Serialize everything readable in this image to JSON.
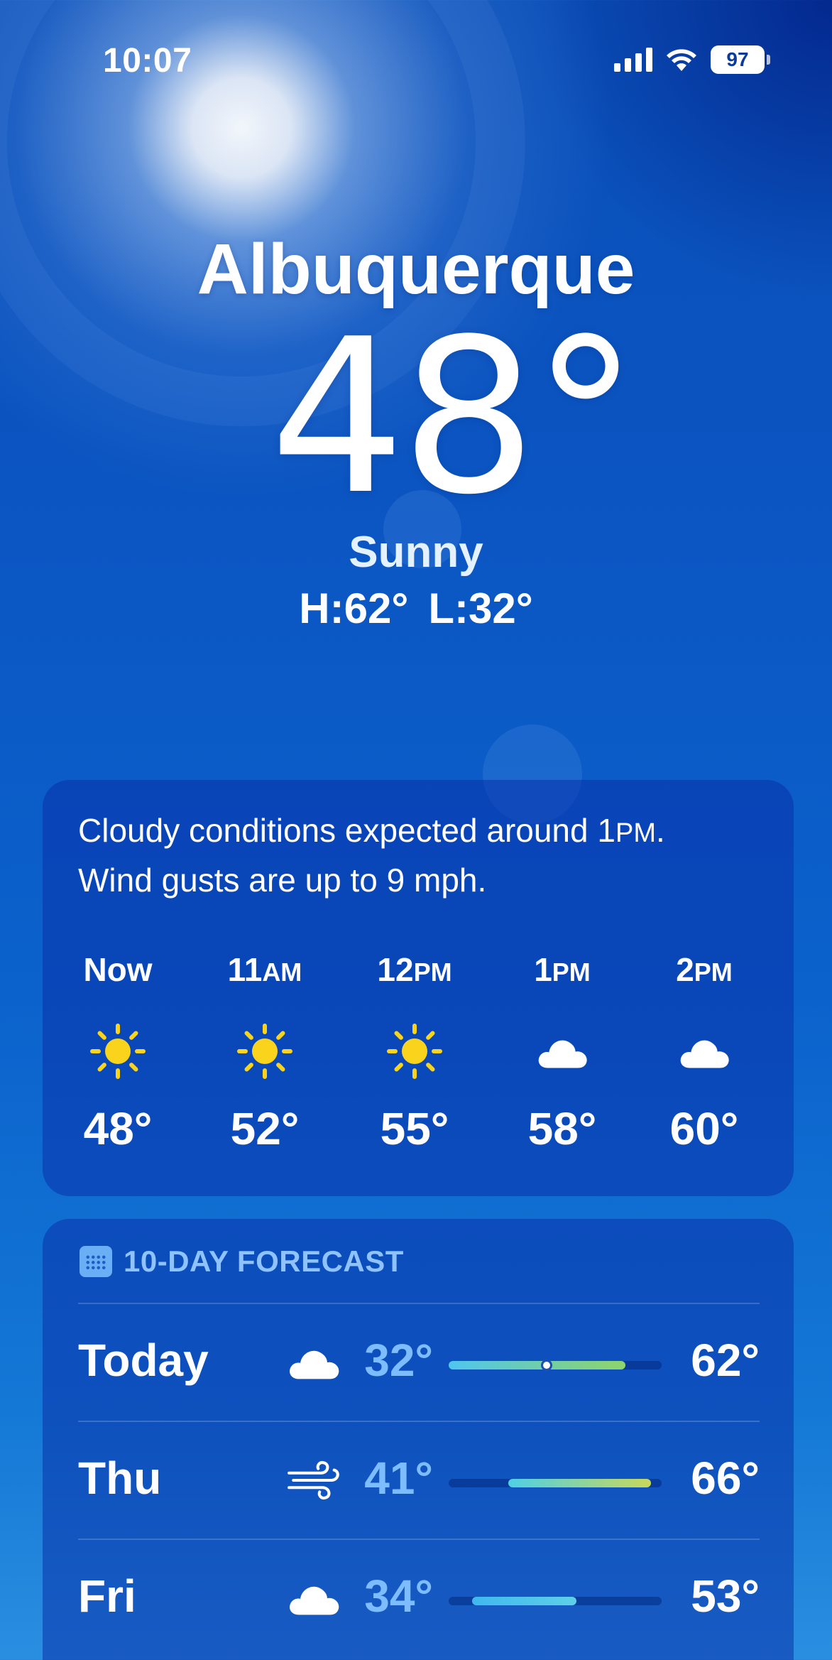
{
  "status_bar": {
    "time": "10:07",
    "battery": "97"
  },
  "location": {
    "city": "Albuquerque",
    "temperature": "48°",
    "condition": "Sunny",
    "high": "H:62°",
    "low": "L:32°"
  },
  "hourly": {
    "summary_line1_a": "Cloudy conditions expected around 1",
    "summary_line1_b": "PM",
    "summary_line1_c": ".",
    "summary_line2": "Wind gusts are up to 9 mph.",
    "hours": [
      {
        "label": "Now",
        "suffix": "",
        "icon": "sun-icon",
        "temp": "48°"
      },
      {
        "label": "11",
        "suffix": "AM",
        "icon": "sun-icon",
        "temp": "52°"
      },
      {
        "label": "12",
        "suffix": "PM",
        "icon": "sun-icon",
        "temp": "55°"
      },
      {
        "label": "1",
        "suffix": "PM",
        "icon": "cloud-icon",
        "temp": "58°"
      },
      {
        "label": "2",
        "suffix": "PM",
        "icon": "cloud-icon",
        "temp": "60°"
      }
    ]
  },
  "forecast": {
    "header": "10-DAY FORECAST",
    "days": [
      {
        "day": "Today",
        "icon": "cloud-icon",
        "low": "32°",
        "high": "62°",
        "range_start": 0.0,
        "range_end": 0.83,
        "current": 0.46,
        "colors": [
          "#4fc6f0",
          "#8ed56a"
        ]
      },
      {
        "day": "Thu",
        "icon": "wind-icon",
        "low": "41°",
        "high": "66°",
        "range_start": 0.28,
        "range_end": 0.95,
        "colors": [
          "#4fd0e6",
          "#c9d85a"
        ]
      },
      {
        "day": "Fri",
        "icon": "cloud-icon",
        "low": "34°",
        "high": "53°",
        "range_start": 0.11,
        "range_end": 0.6,
        "colors": [
          "#3fb8ee",
          "#5ed0e8"
        ]
      }
    ]
  },
  "colors": {
    "sun": "#f9d31c",
    "low_temp": "#7cbcff",
    "header": "#8fc3ff"
  }
}
